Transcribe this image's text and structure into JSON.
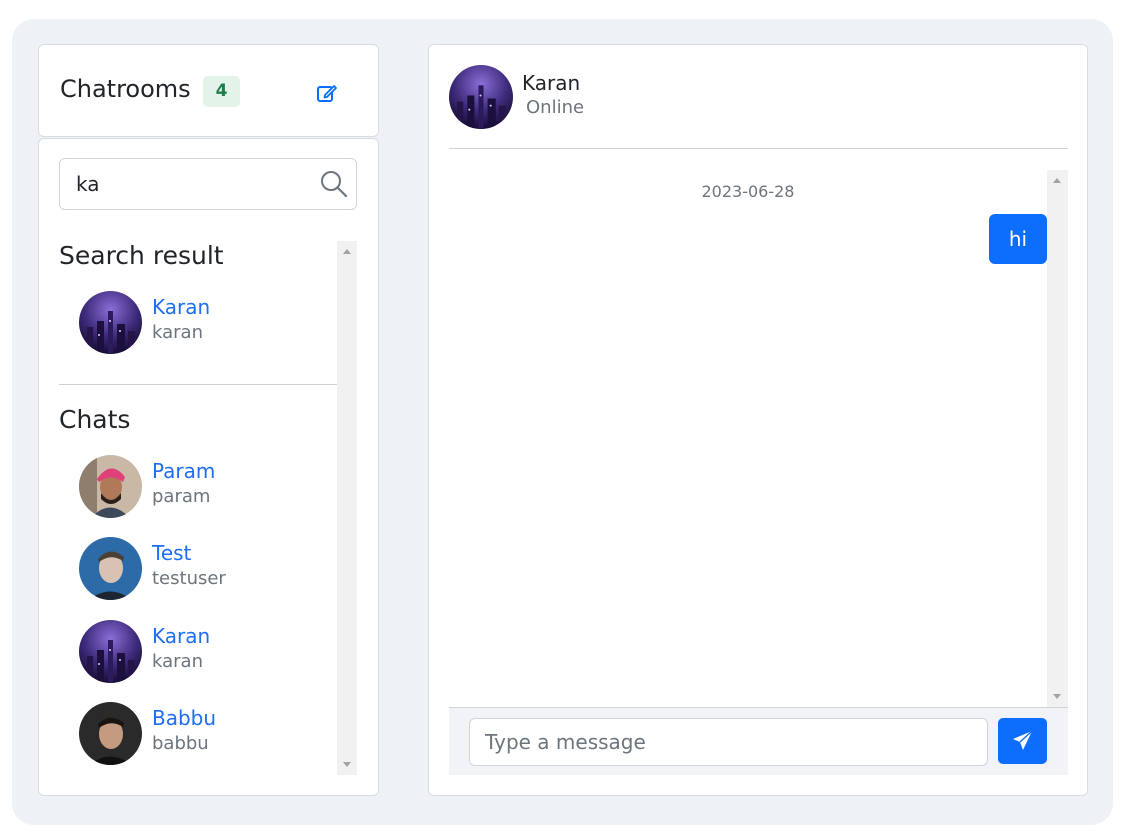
{
  "colors": {
    "accent": "#0d6efd",
    "link": "#1d6ef0",
    "badge_bg": "#e3f3ea",
    "badge_text": "#1a7f4b",
    "background": "#eef1f6"
  },
  "sidebar": {
    "title": "Chatrooms",
    "count": "4",
    "edit_icon": "edit-square-icon",
    "search": {
      "value": "ka",
      "icon": "search-icon"
    },
    "search_result": {
      "heading": "Search result",
      "items": [
        {
          "name": "Karan",
          "username": "karan"
        }
      ]
    },
    "chats": {
      "heading": "Chats",
      "items": [
        {
          "name": "Param",
          "username": "param"
        },
        {
          "name": "Test",
          "username": "testuser"
        },
        {
          "name": "Karan",
          "username": "karan"
        },
        {
          "name": "Babbu",
          "username": "babbu"
        }
      ]
    }
  },
  "chat": {
    "contact_name": "Karan",
    "status": "Online",
    "messages": [
      {
        "date": "2023-06-28",
        "text": "hi",
        "direction": "outgoing"
      }
    ],
    "composer": {
      "placeholder": "Type a message",
      "send_icon": "send-icon"
    }
  }
}
